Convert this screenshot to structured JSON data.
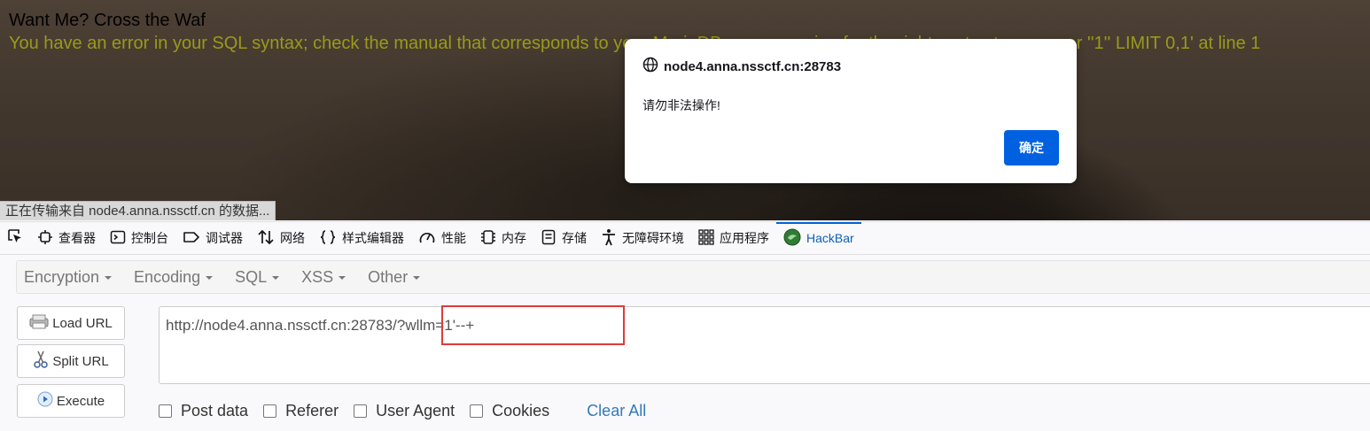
{
  "page": {
    "title": "Want Me? Cross the Waf",
    "error": "You have an error in your SQL syntax; check the manual that corresponds to your MariaDB server version for the right syntax to use near ''1'' LIMIT 0,1' at line 1",
    "status_text": "正在传输来自 node4.anna.nssctf.cn 的数据..."
  },
  "dialog": {
    "origin": "node4.anna.nssctf.cn:28783",
    "message": "请勿非法操作!",
    "ok_label": "确定"
  },
  "devtools": {
    "tabs": [
      {
        "label": "查看器",
        "icon": "inspector-icon"
      },
      {
        "label": "控制台",
        "icon": "console-icon"
      },
      {
        "label": "调试器",
        "icon": "debugger-icon"
      },
      {
        "label": "网络",
        "icon": "network-icon"
      },
      {
        "label": "样式编辑器",
        "icon": "style-editor-icon"
      },
      {
        "label": "性能",
        "icon": "performance-icon"
      },
      {
        "label": "内存",
        "icon": "memory-icon"
      },
      {
        "label": "存储",
        "icon": "storage-icon"
      },
      {
        "label": "无障碍环境",
        "icon": "accessibility-icon"
      },
      {
        "label": "应用程序",
        "icon": "application-icon"
      },
      {
        "label": "HackBar",
        "icon": "hackbar-icon",
        "active": true
      }
    ]
  },
  "hackbar": {
    "menu": [
      "Encryption",
      "Encoding",
      "SQL",
      "XSS",
      "Other"
    ],
    "buttons": {
      "load": "Load URL",
      "split": "Split URL",
      "execute": "Execute"
    },
    "url": "http://node4.anna.nssctf.cn:28783/?wllm=1'--+",
    "options": [
      "Post data",
      "Referer",
      "User Agent",
      "Cookies"
    ],
    "clear_all": "Clear All"
  },
  "colors": {
    "accent": "#0061e0",
    "error_text": "#9a9a1a",
    "highlight": "#e03a3a",
    "link": "#337ab7"
  }
}
